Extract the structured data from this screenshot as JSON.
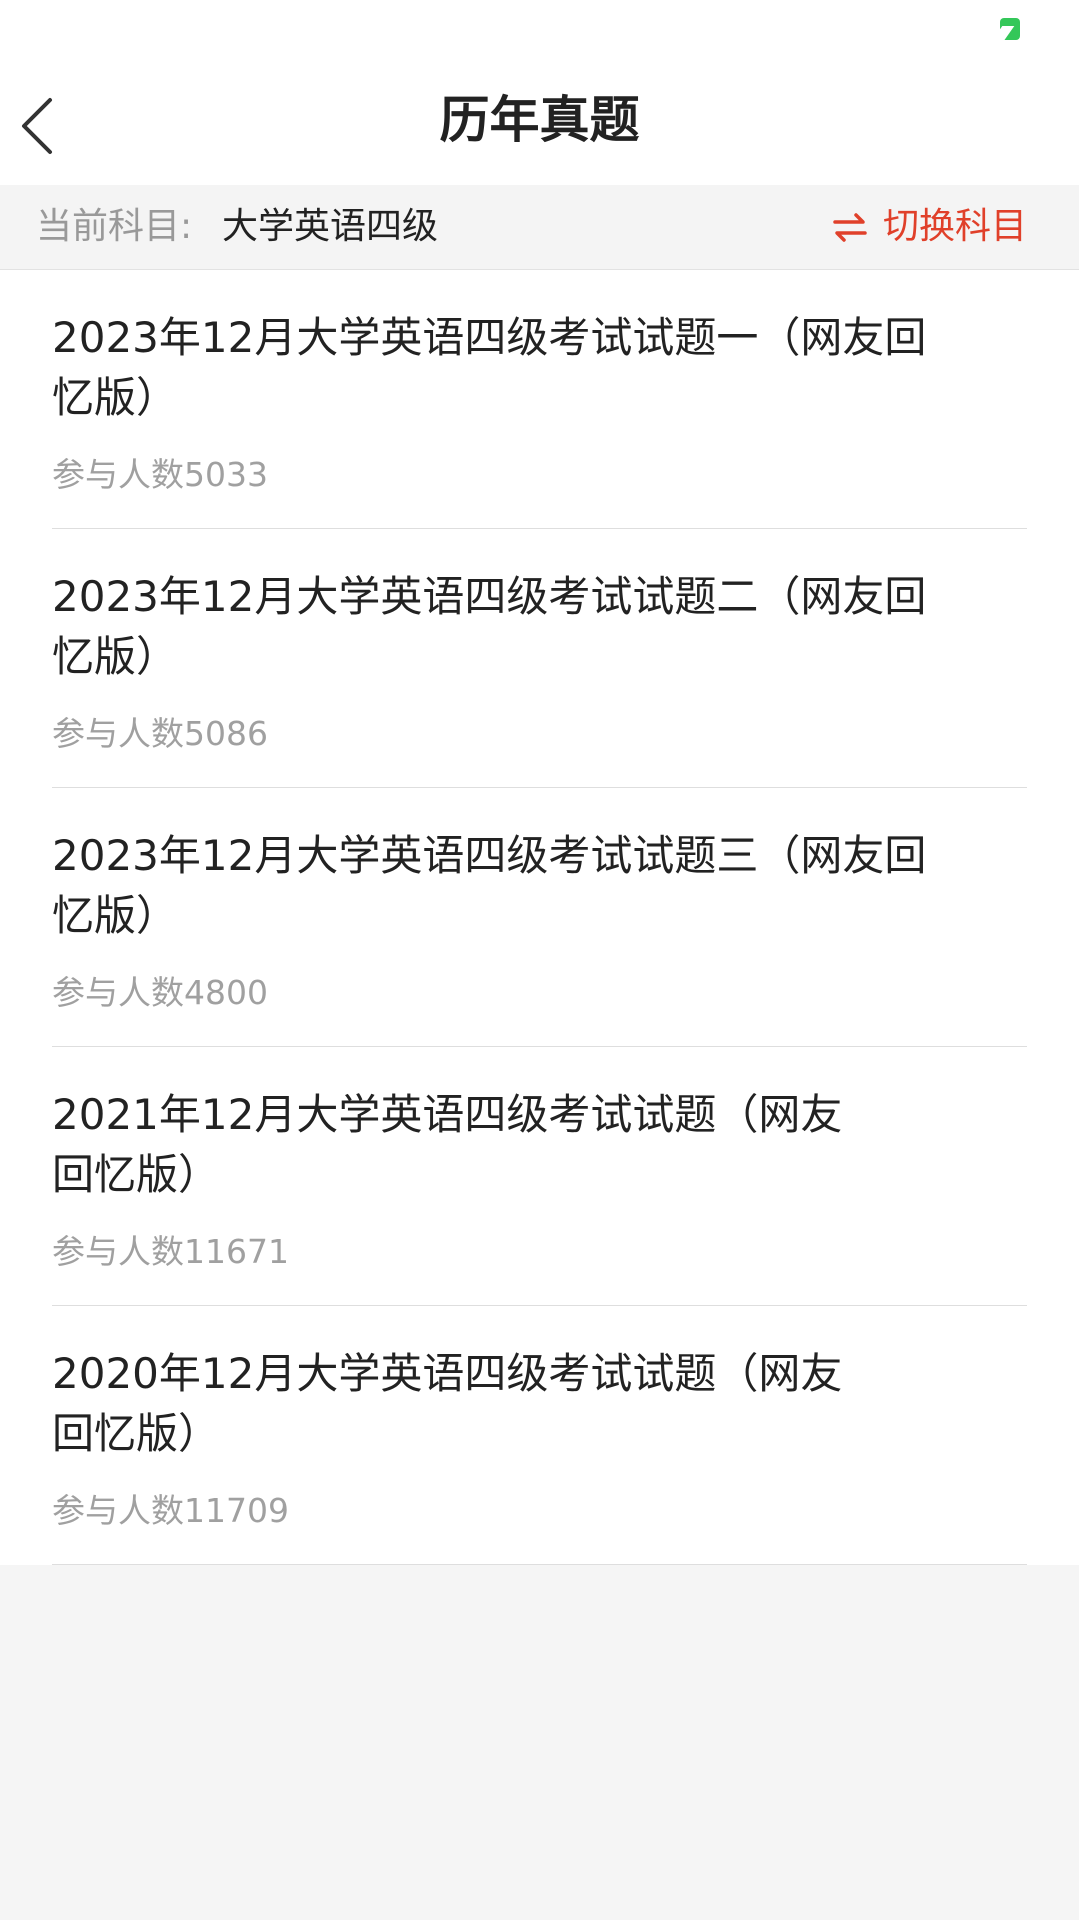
{
  "header": {
    "title": "历年真题"
  },
  "subject_bar": {
    "label": "当前科目:",
    "value": "大学英语四级",
    "switch_label": "切换科目"
  },
  "list": {
    "count_prefix": "参与人数",
    "items": [
      {
        "title_line1": "2023年12月大学英语四级考试试题一（网友回",
        "title_line2": "忆版）",
        "count": "5033"
      },
      {
        "title_line1": "2023年12月大学英语四级考试试题二（网友回",
        "title_line2": "忆版）",
        "count": "5086"
      },
      {
        "title_line1": "2023年12月大学英语四级考试试题三（网友回",
        "title_line2": "忆版）",
        "count": "4800"
      },
      {
        "title_line1": "2021年12月大学英语四级考试试题（网友",
        "title_line2": "回忆版）",
        "count": "11671"
      },
      {
        "title_line1": "2020年12月大学英语四级考试试题（网友",
        "title_line2": "回忆版）",
        "count": "11709"
      }
    ]
  },
  "colors": {
    "accent": "#e0402a",
    "battery": "#34c759",
    "background": "#f5f5f5"
  },
  "icons": {
    "back": "chevron-left-icon",
    "switch": "swap-arrows-icon",
    "battery": "battery-icon"
  }
}
